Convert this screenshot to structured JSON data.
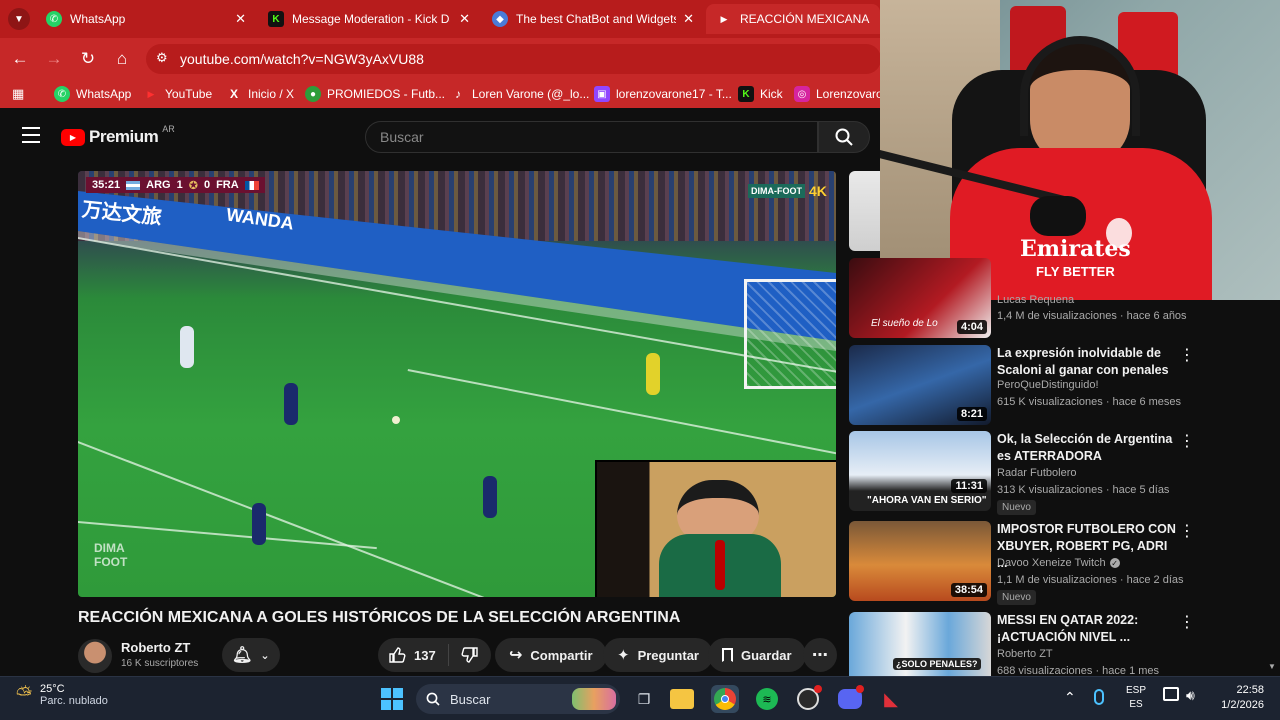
{
  "browser": {
    "tabs": [
      {
        "label": "WhatsApp",
        "icon": "whatsapp-icon",
        "color": "#25d366"
      },
      {
        "label": "Message Moderation - Kick Da",
        "icon": "kick-icon",
        "color": "#53fc18"
      },
      {
        "label": "The best ChatBot and Widgets",
        "icon": "chatbot-icon",
        "color": "#4a7bd8"
      },
      {
        "label": "REACCIÓN MEXICANA A GO",
        "icon": "youtube-icon",
        "color": "#ff0000"
      }
    ],
    "url": "youtube.com/watch?v=NGW3yAxVU88",
    "bookmarks": [
      {
        "label": "WhatsApp",
        "icon": "whatsapp-icon"
      },
      {
        "label": "YouTube",
        "icon": "youtube-icon"
      },
      {
        "label": "Inicio / X",
        "icon": "x-icon"
      },
      {
        "label": "PROMIEDOS - Futb...",
        "icon": "promiedos-icon"
      },
      {
        "label": "Loren Varone (@_lo...",
        "icon": "tiktok-icon"
      },
      {
        "label": "lorenzovarone17 - T...",
        "icon": "twitch-icon"
      },
      {
        "label": "Kick",
        "icon": "kick-icon"
      },
      {
        "label": "Lorenzovaron",
        "icon": "instagram-icon"
      }
    ]
  },
  "youtube": {
    "logo_text": "Premium",
    "region": "AR",
    "search_placeholder": "Buscar"
  },
  "video": {
    "scorebug": {
      "time": "35:21",
      "home": "ARG",
      "home_score": "1",
      "away_score": "0",
      "away": "FRA"
    },
    "channel_mark": "DIMA-FOOT",
    "quality_badge": "4K",
    "watermark": "DIMA FOOT",
    "ad_text_1": "万达文旅",
    "ad_text_2": "WANDA",
    "title": "REACCIÓN MEXICANA A GOLES HISTÓRICOS DE LA SELECCIÓN ARGENTINA",
    "channel": "Roberto ZT",
    "subscribers": "16 K suscriptores",
    "likes": "137",
    "share_label": "Compartir",
    "ask_label": "Preguntar",
    "save_label": "Guardar"
  },
  "recommendations": [
    {
      "title": "",
      "channel": "Lucas Requena",
      "meta": "1,4 M de visualizaciones · hace 6 años",
      "duration": "4:04",
      "thumb_caption": "El sueño de Lo",
      "new": false
    },
    {
      "title": "La expresión inolvidable de Scaloni al ganar con penales",
      "channel": "PeroQueDistinguido!",
      "meta": "615 K visualizaciones · hace 6 meses",
      "duration": "8:21",
      "new": false
    },
    {
      "title": "Ok, la Selección de Argentina es ATERRADORA",
      "channel": "Radar Futbolero",
      "meta": "313 K visualizaciones · hace 5 días",
      "duration": "11:31",
      "thumb_caption": "\"AHORA VAN EN SERIO\"",
      "new": true,
      "new_label": "Nuevo"
    },
    {
      "title": "IMPOSTOR FUTBOLERO CON XBUYER, ROBERT PG, ADRI ...",
      "channel": "Davoo Xeneize Twitch",
      "meta": "1,1 M de visualizaciones · hace 2 días",
      "duration": "38:54",
      "new": true,
      "new_label": "Nuevo"
    },
    {
      "title": "MESSI EN QATAR 2022: ¡ACTUACIÓN NIVEL ...",
      "channel": "Roberto ZT",
      "meta": "688 visualizaciones · hace 1 mes",
      "thumb_caption": "¿SOLO PENALES?",
      "new": false
    }
  ],
  "webcam": {
    "shirt_text": "Emirates",
    "shirt_subtext": "FLY BETTER"
  },
  "taskbar": {
    "weather_temp": "25°C",
    "weather_desc": "Parc. nublado",
    "search_placeholder": "Buscar",
    "lang_top": "ESP",
    "lang_bottom": "ES",
    "time": "22:58",
    "date": "1/2/2026"
  },
  "colors": {
    "accent": "#c62828",
    "tabstrip": "#b71c1c",
    "yt_red": "#ff0000"
  }
}
